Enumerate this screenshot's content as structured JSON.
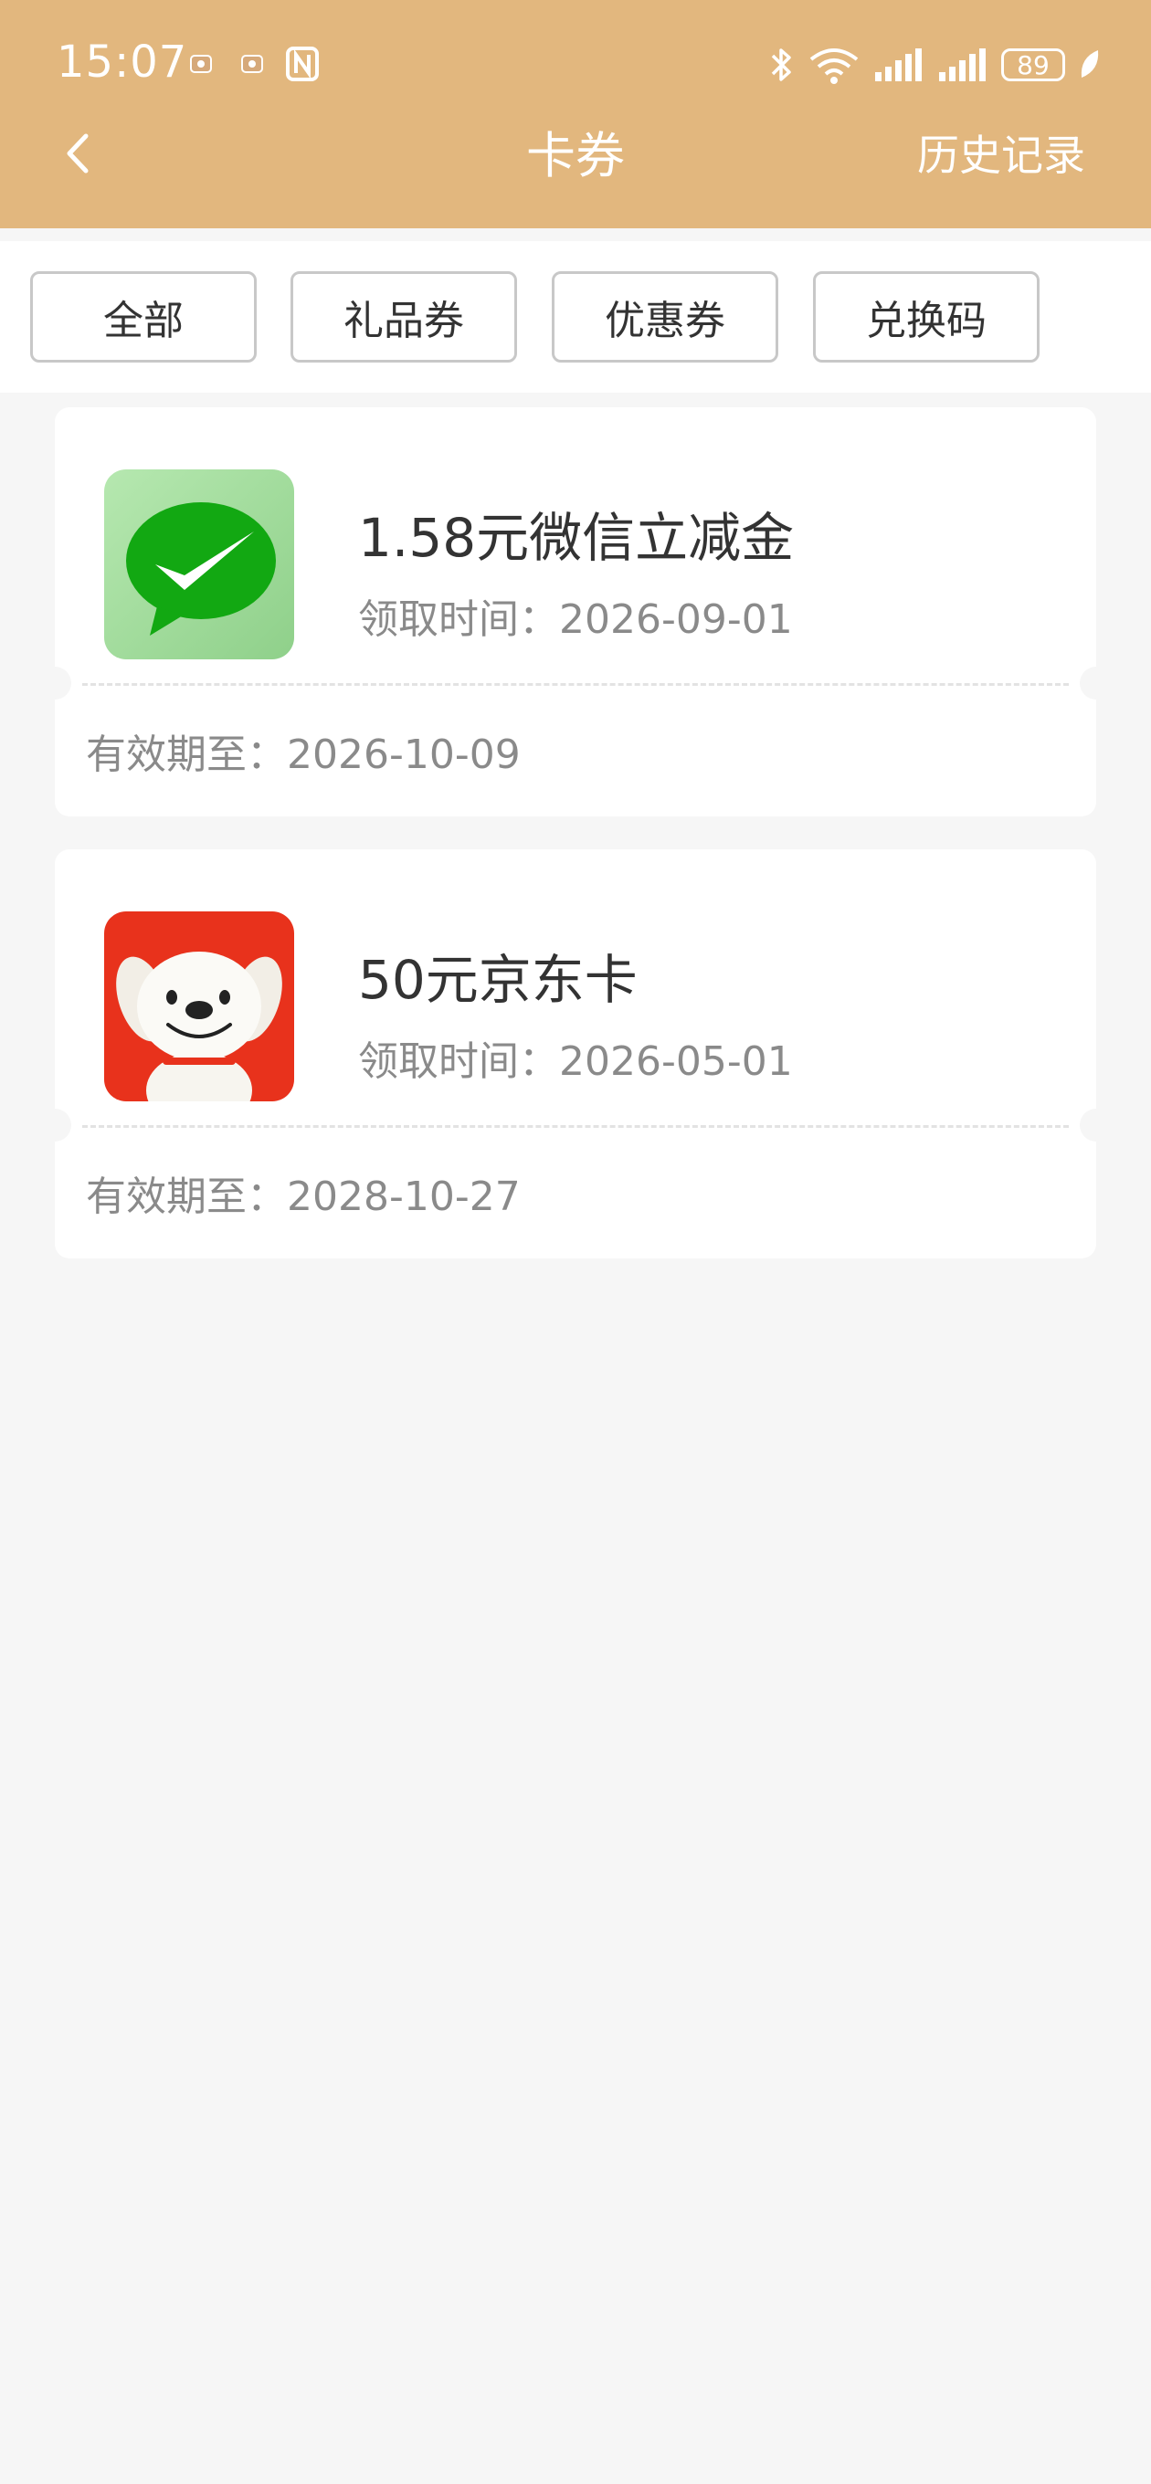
{
  "status_bar": {
    "time": "15:07",
    "battery": "89",
    "icons": [
      "app-notification-icon",
      "app-notification-icon",
      "nfc-icon",
      "bluetooth-icon",
      "wifi-icon",
      "signal-icon",
      "signal-icon",
      "battery-icon",
      "leaf-icon"
    ]
  },
  "header": {
    "title": "卡券",
    "history_label": "历史记录",
    "back_icon": "chevron-left-icon",
    "bg_color": "#e2b77e"
  },
  "tabs": [
    {
      "label": "全部"
    },
    {
      "label": "礼品券"
    },
    {
      "label": "优惠券"
    },
    {
      "label": "兑换码"
    }
  ],
  "cards": [
    {
      "name": "1.58元微信立减金",
      "received": "领取时间：2026-09-01",
      "valid_until": "有效期至：2026-10-09",
      "logo_icon": "wechat-logo-icon",
      "logo_color": "#1aad19"
    },
    {
      "name": "50元京东卡",
      "received": "领取时间：2026-05-01",
      "valid_until": "有效期至：2028-10-27",
      "logo_icon": "jd-mascot-logo-icon",
      "logo_color": "#e8321c"
    }
  ]
}
